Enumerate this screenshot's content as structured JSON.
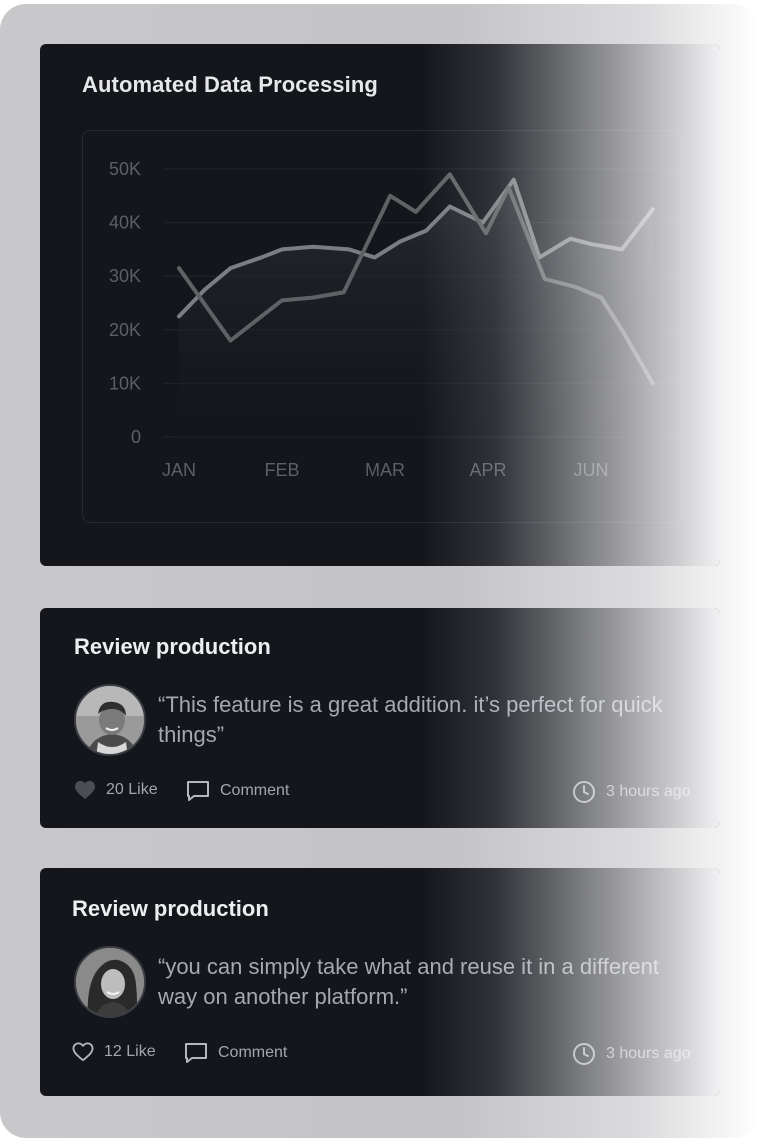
{
  "chart_card": {
    "title": "Automated Data Processing"
  },
  "chart_data": {
    "type": "line",
    "title": "Automated Data Processing",
    "categories": [
      "JAN",
      "FEB",
      "MAR",
      "APR",
      "JUN"
    ],
    "y_ticks": [
      "50K",
      "40K",
      "30K",
      "20K",
      "10K",
      "0"
    ],
    "ylim": [
      0,
      50000
    ],
    "grid": true,
    "series": [
      {
        "x": [
          0,
          0.25,
          0.5,
          0.8,
          1.0,
          1.3,
          1.65,
          1.9,
          2.15,
          2.4,
          2.63,
          2.95,
          3.25,
          3.5,
          3.8,
          4.0,
          4.3,
          4.6
        ],
        "values": [
          22500,
          27500,
          31500,
          33500,
          35000,
          35500,
          35000,
          33500,
          36500,
          38500,
          43000,
          40000,
          48000,
          33500,
          37000,
          36000,
          35000,
          42500
        ]
      },
      {
        "x": [
          0,
          0.5,
          1.0,
          1.3,
          1.6,
          2.05,
          2.3,
          2.63,
          2.98,
          3.2,
          3.55,
          3.85,
          4.1,
          4.3,
          4.6
        ],
        "values": [
          31500,
          18000,
          25500,
          26000,
          27000,
          45000,
          42000,
          49000,
          38000,
          46500,
          29500,
          28000,
          26000,
          20000,
          10000
        ]
      }
    ]
  },
  "reviews": [
    {
      "title": "Review production",
      "quote": "“This feature is a great addition. it’s perfect for quick things”",
      "likes": "20 Like",
      "comment_label": "Comment",
      "time": "3 hours ago",
      "liked": true
    },
    {
      "title": "Review production",
      "quote": "“you can simply take what  and reuse it in a different way on another platform.”",
      "likes": "12 Like",
      "comment_label": "Comment",
      "time": "3 hours ago",
      "liked": false
    }
  ],
  "icons": {
    "like_filled": "heart-icon",
    "like_outline": "heart-outline-icon",
    "comment": "comment-icon",
    "time": "clock-icon"
  },
  "colors": {
    "card_bg": "#14161c",
    "text_primary": "#eceef1",
    "text_secondary": "#a5a8b0",
    "line_a": "#7b7d82",
    "line_b": "#5f6165"
  }
}
